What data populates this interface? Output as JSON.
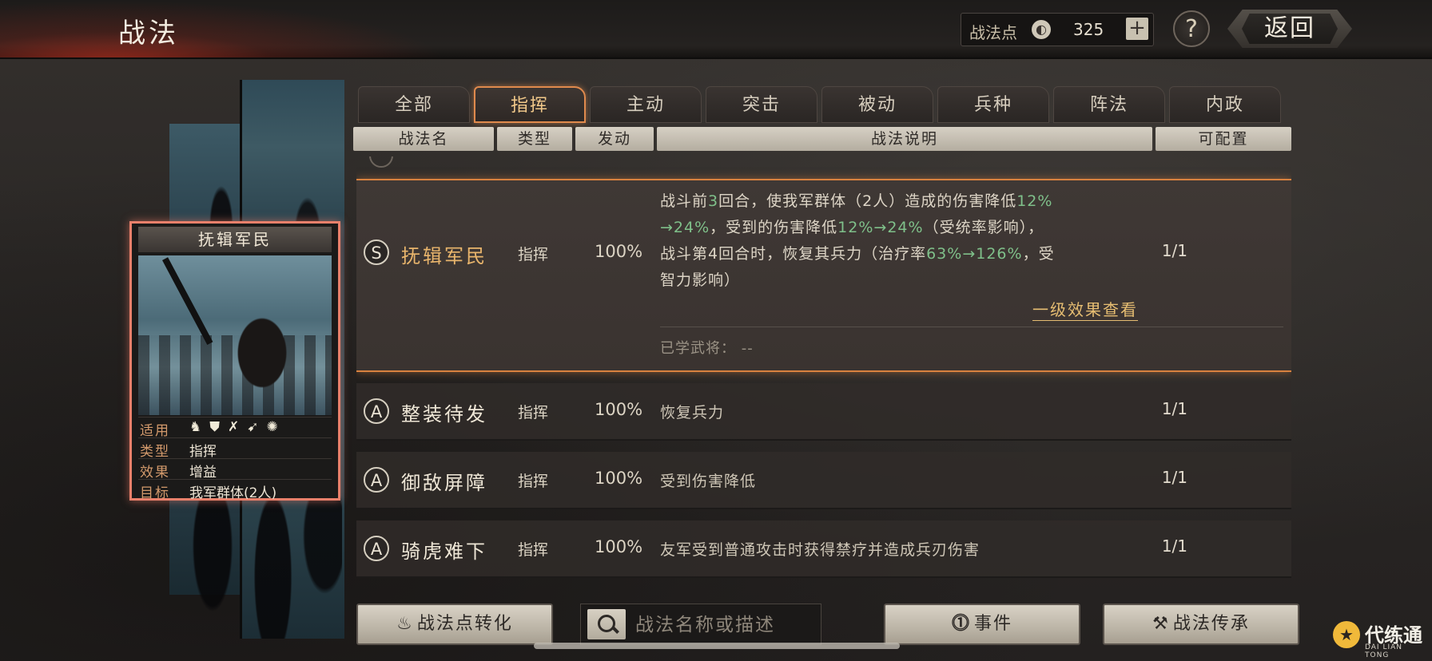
{
  "header": {
    "title": "战法",
    "points_label": "战法点",
    "points_value": "325",
    "plus_label": "+",
    "help_label": "?",
    "back_label": "返回"
  },
  "card": {
    "title": "抚辑军民",
    "rows": [
      {
        "key": "适用",
        "value": ""
      },
      {
        "key": "类型",
        "value": "指挥"
      },
      {
        "key": "效果",
        "value": "增益"
      },
      {
        "key": "目标",
        "value": "我军群体(2人)"
      }
    ],
    "unit_icons": [
      "cavalry-icon",
      "shield-icon",
      "bow-icon",
      "spear-icon",
      "wheel-icon"
    ]
  },
  "tabs": [
    "全部",
    "指挥",
    "主动",
    "突击",
    "被动",
    "兵种",
    "阵法",
    "内政"
  ],
  "active_tab": "指挥",
  "columns": {
    "name": "战法名",
    "type": "类型",
    "trigger": "发动",
    "desc": "战法说明",
    "config": "可配置"
  },
  "expanded": {
    "grade": "S",
    "name": "抚辑军民",
    "type": "指挥",
    "rate": "100%",
    "config": "1/1",
    "desc_lines": [
      {
        "parts": [
          {
            "t": "战斗前",
            "g": false
          },
          {
            "t": "3",
            "g": true
          },
          {
            "t": "回合，使我军群体（2人）造成的伤害降低",
            "g": false
          },
          {
            "t": "12%",
            "g": true
          }
        ]
      },
      {
        "parts": [
          {
            "t": "→24%",
            "g": true
          },
          {
            "t": "，受到的伤害降低",
            "g": false
          },
          {
            "t": "12%→24%",
            "g": true
          },
          {
            "t": "（受统率影响），",
            "g": false
          }
        ]
      },
      {
        "parts": [
          {
            "t": "战斗第4回合时，恢复其兵力（治疗率",
            "g": false
          },
          {
            "t": "63%→126%",
            "g": true
          },
          {
            "t": "，受",
            "g": false
          }
        ]
      },
      {
        "parts": [
          {
            "t": "智力影响）",
            "g": false
          }
        ]
      }
    ],
    "effect_link": "一级效果查看",
    "learned_label": "已学武将：",
    "learned_value": "--"
  },
  "rows": [
    {
      "grade": "A",
      "name": "整装待发",
      "type": "指挥",
      "rate": "100%",
      "desc": "恢复兵力",
      "config": "1/1"
    },
    {
      "grade": "A",
      "name": "御敌屏障",
      "type": "指挥",
      "rate": "100%",
      "desc": "受到伤害降低",
      "config": "1/1"
    },
    {
      "grade": "A",
      "name": "骑虎难下",
      "type": "指挥",
      "rate": "100%",
      "desc": "友军受到普通攻击时获得禁疗并造成兵刃伤害",
      "config": "1/1"
    }
  ],
  "footer": {
    "convert_label": "战法点转化",
    "search_placeholder": "战法名称或描述",
    "events_label": "事件",
    "inherit_label": "战法传承"
  },
  "watermark": {
    "title": "代练通",
    "sub": "DAI LIAN TONG"
  }
}
